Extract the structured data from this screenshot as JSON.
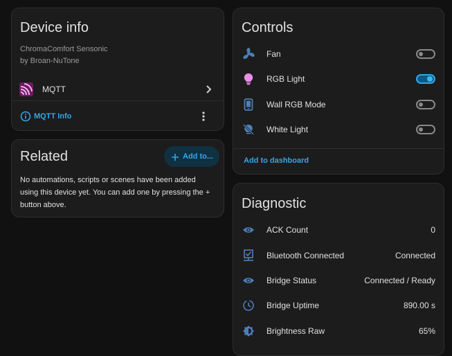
{
  "device_info": {
    "title": "Device info",
    "model": "ChromaComfort Sensonic",
    "manufacturer": "by Broan-NuTone",
    "integration": "MQTT",
    "info_link": "MQTT Info"
  },
  "related": {
    "title": "Related",
    "add_button": "Add to...",
    "message": "No automations, scripts or scenes have been added using this device yet. You can add one by pressing the + button above."
  },
  "controls": {
    "title": "Controls",
    "items": [
      {
        "label": "Fan",
        "icon": "fan-icon",
        "on": false
      },
      {
        "label": "RGB Light",
        "icon": "lightbulb-icon",
        "on": true
      },
      {
        "label": "Wall RGB Mode",
        "icon": "tablet-icon",
        "on": false
      },
      {
        "label": "White Light",
        "icon": "lightbulb-off-icon",
        "on": false
      }
    ],
    "add_to_dashboard": "Add to dashboard"
  },
  "diagnostic": {
    "title": "Diagnostic",
    "items": [
      {
        "label": "ACK Count",
        "value": "0",
        "icon": "eye-icon"
      },
      {
        "label": "Bluetooth Connected",
        "value": "Connected",
        "icon": "checkbox-connected-icon"
      },
      {
        "label": "Bridge Status",
        "value": "Connected / Ready",
        "icon": "eye-icon"
      },
      {
        "label": "Bridge Uptime",
        "value": "890.00 s",
        "icon": "clock-icon"
      },
      {
        "label": "Brightness Raw",
        "value": "65%",
        "icon": "brightness-icon"
      }
    ]
  },
  "colors": {
    "accent": "#35a7e7",
    "icon_blue": "#4e7fb8",
    "bulb_pink": "#ea8ce8",
    "mqtt_magenta": "#7a1d6e"
  }
}
